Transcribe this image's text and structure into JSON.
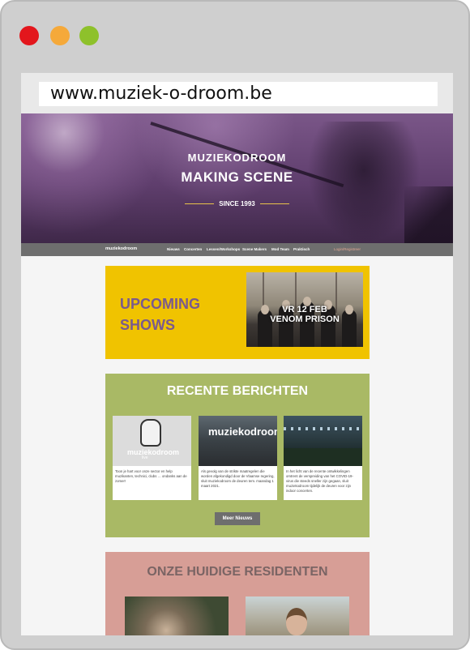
{
  "browser": {
    "url": "www.muziek-o-droom.be"
  },
  "hero": {
    "brand": "MUZIEKODROOM",
    "title": "MAKING SCENE",
    "since": "SINCE 1993"
  },
  "nav": {
    "logo": "muziekodroom",
    "items": [
      "Nieuws",
      "Concerten",
      "Lessen/Workshops",
      "Scene Makers",
      "Mod Team",
      "Praktisch"
    ],
    "login": "Login/Registreer"
  },
  "upcoming": {
    "title": "UPCOMING SHOWS",
    "show_date": "VR 12 FEB",
    "show_name": "VENOM PRISON"
  },
  "recent": {
    "title": "RECENTE BERICHTEN",
    "posts": [
      {
        "thumb_logo": "muziekodroom",
        "thumb_sub": "live",
        "text": "Toon je hart voor onze sector en help muzikanten, technici, clubs … ondanks aan de zomer!"
      },
      {
        "thumb_logo": "muziekodroom",
        "text": "Als gevolg van de strikte maatregelen die worden afgekondigd door de Vlaamse regering, sluit muziekodroom de deuren tem. maandag 1 maart 2021."
      },
      {
        "text": "In het licht van de recente ontwikkelingen omtrent de verspreiding van het COVID-19-virus die steeds sneller zijn gegaan, sluit muziekodroom tijdelijk de deuren voor zijn indoor concerten."
      }
    ],
    "more_button": "Meer Nieuws"
  },
  "residents": {
    "title": "ONZE HUIDIGE RESIDENTEN"
  }
}
